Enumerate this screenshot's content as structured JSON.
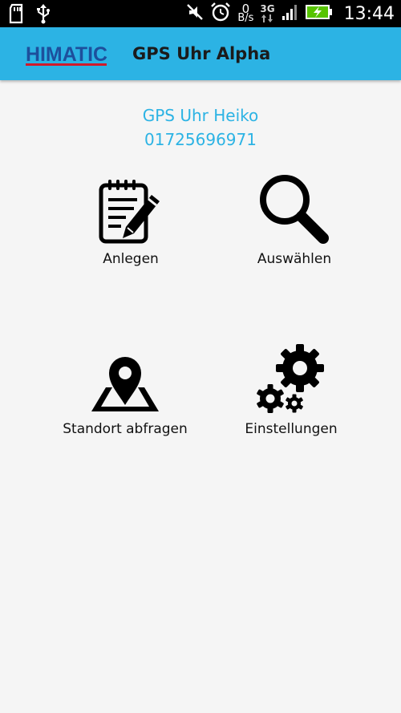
{
  "status_bar": {
    "time": "13:44",
    "net_speed_value": "0",
    "net_speed_unit": "B/s",
    "network_type": "3G"
  },
  "action_bar": {
    "logo_text": "HIMATIC",
    "title": "GPS Uhr Alpha"
  },
  "device": {
    "name": "GPS Uhr Heiko",
    "phone": "01725696971"
  },
  "menu": {
    "create_label": "Anlegen",
    "select_label": "Auswählen",
    "locate_label": "Standort abfragen",
    "settings_label": "Einstellungen"
  },
  "colors": {
    "accent": "#2cb3e4",
    "logo_blue": "#1d4f9c",
    "logo_red": "#d11a2a",
    "background": "#f5f5f5"
  }
}
